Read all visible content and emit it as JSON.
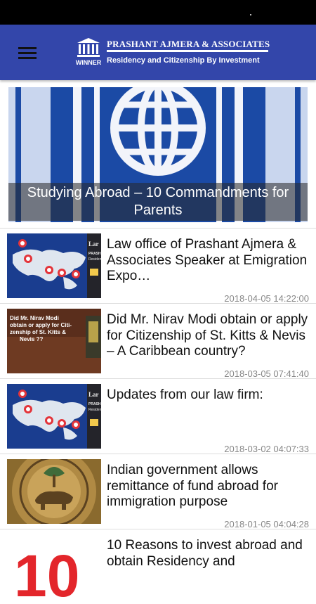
{
  "app_bar": {
    "logo_badge": "WINNER",
    "logo_name": "PRASHANT AJMERA & ASSOCIATES",
    "logo_tagline": "Residency and Citizenship By Investment"
  },
  "hero": {
    "caption": "Studying Abroad – 10 Commandments for Parents"
  },
  "articles": [
    {
      "title": "Law office of Prashant Ajmera & Associates Speaker at Emigration Expo…",
      "date": "2018-04-05 14:22:00",
      "thumb": "world-map"
    },
    {
      "title": "Did Mr. Nirav Modi obtain or apply for Citizenship of St. Kitts & Nevis – A Caribbean country?",
      "date": "2018-03-05 07:41:40",
      "thumb": "text-card",
      "thumb_text": "Did Mr. Nirav Modi obtain or apply for Citi- zenship of St. Kitts & Nevis ??"
    },
    {
      "title": "Updates from our law firm:",
      "date": "2018-03-02 04:07:33",
      "thumb": "world-map"
    },
    {
      "title": "Indian government allows remittance of fund abroad for immigration purpose",
      "date": "2018-01-05 04:04:28",
      "thumb": "rbi-seal"
    },
    {
      "title": "10 Reasons to invest abroad and obtain Residency and",
      "date": "",
      "thumb": "ten-graphic",
      "thumb_text": "10"
    }
  ],
  "colors": {
    "app_bar": "#3346aa",
    "status_bar": "#000000"
  }
}
